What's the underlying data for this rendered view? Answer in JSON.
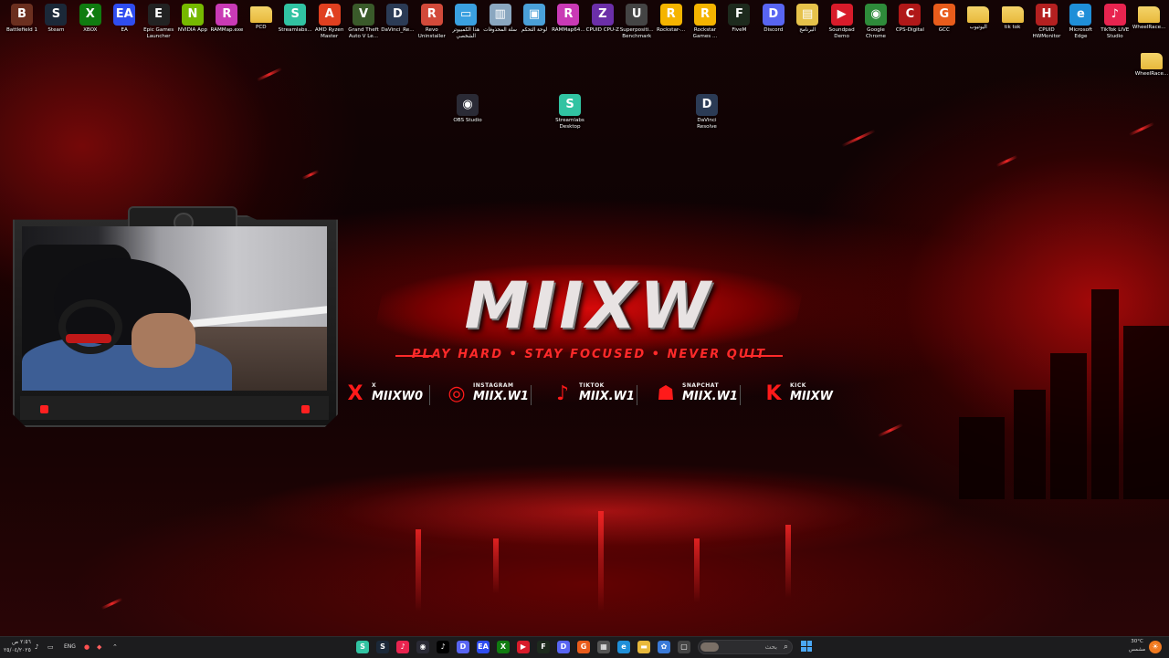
{
  "wallpaper": {
    "brand_title": "MIIXW",
    "tagline": "PLAY HARD • STAY FOCUSED • NEVER QUIT",
    "socials": [
      {
        "network": "X",
        "handle": "MIIXW0",
        "icon": "x-logo-icon",
        "glyph": "X"
      },
      {
        "network": "INSTAGRAM",
        "handle": "MIIX.W1",
        "icon": "instagram-icon",
        "glyph": "◎"
      },
      {
        "network": "TIKTOK",
        "handle": "MIIX.W1",
        "icon": "tiktok-icon",
        "glyph": "♪"
      },
      {
        "network": "SNAPCHAT",
        "handle": "MIIX.W1",
        "icon": "snapchat-icon",
        "glyph": "☗"
      },
      {
        "network": "KICK",
        "handle": "MIIXW",
        "icon": "kick-icon",
        "glyph": "K"
      }
    ],
    "accent_color": "#ff1a1a"
  },
  "desktop_icons_top": [
    {
      "label": "Battlefield 1",
      "icon": "battlefield-icon",
      "color": "#6b2f1f",
      "glyph": "B"
    },
    {
      "label": "Steam",
      "icon": "steam-icon",
      "color": "#1b2838",
      "glyph": "S"
    },
    {
      "label": "XBOX",
      "icon": "xbox-icon",
      "color": "#107c10",
      "glyph": "X"
    },
    {
      "label": "EA",
      "icon": "ea-icon",
      "color": "#2f4df0",
      "glyph": "EA"
    },
    {
      "label": "Epic Games Launcher",
      "icon": "epic-games-icon",
      "color": "#222",
      "glyph": "E"
    },
    {
      "label": "NVIDIA App",
      "icon": "nvidia-icon",
      "color": "#76b900",
      "glyph": "N"
    },
    {
      "label": "RAMMap.exe",
      "icon": "rammap-icon",
      "color": "#c93ab5",
      "glyph": "R"
    },
    {
      "label": "PCD",
      "icon": "folder-icon",
      "color": "#e8b93c",
      "glyph": ""
    },
    {
      "label": "Streamlabs...",
      "icon": "streamlabs-icon",
      "color": "#31c3a2",
      "glyph": "S"
    },
    {
      "label": "AMD Ryzen Master",
      "icon": "amd-ryzen-icon",
      "color": "#e04020",
      "glyph": "A"
    },
    {
      "label": "Grand Theft Auto V Le...",
      "icon": "gta-v-icon",
      "color": "#3a5a2a",
      "glyph": "V"
    },
    {
      "label": "DaVinci_Re...",
      "icon": "davinci-icon",
      "color": "#2b3b55",
      "glyph": "D"
    },
    {
      "label": "Revo Uninstaller",
      "icon": "revo-uninstaller-icon",
      "color": "#d24a3a",
      "glyph": "R"
    },
    {
      "label": "هذا الكمبيوتر الشخصي",
      "icon": "this-pc-icon",
      "color": "#3aa0e0",
      "glyph": "▭"
    },
    {
      "label": "سلة المحذوفات",
      "icon": "recycle-bin-icon",
      "color": "#8aa7c0",
      "glyph": "▥"
    },
    {
      "label": "لوحة التحكم",
      "icon": "control-panel-icon",
      "color": "#4aa0d8",
      "glyph": "▣"
    },
    {
      "label": "RAMMap64...",
      "icon": "rammap64-icon",
      "color": "#c93ab5",
      "glyph": "R"
    },
    {
      "label": "CPUID CPU-Z",
      "icon": "cpu-z-icon",
      "color": "#6b2fa8",
      "glyph": "Z"
    },
    {
      "label": "Superpositi... Benchmark",
      "icon": "superposition-icon",
      "color": "#444",
      "glyph": "U"
    },
    {
      "label": "Rockstar-...",
      "icon": "rockstar-icon",
      "color": "#f5b400",
      "glyph": "R"
    },
    {
      "label": "Rockstar Games ...",
      "icon": "rockstar-games-icon",
      "color": "#f5b400",
      "glyph": "R"
    },
    {
      "label": "FiveM",
      "icon": "fivem-icon",
      "color": "#1d2a1d",
      "glyph": "F"
    },
    {
      "label": "Discord",
      "icon": "discord-icon",
      "color": "#5865f2",
      "glyph": "D"
    },
    {
      "label": "البرنامج",
      "icon": "program-icon",
      "color": "#e6c24a",
      "glyph": "▤"
    },
    {
      "label": "Soundpad Demo",
      "icon": "soundpad-icon",
      "color": "#d81b2a",
      "glyph": "▶"
    },
    {
      "label": "Google Chrome",
      "icon": "chrome-icon",
      "color": "#2e8b3a",
      "glyph": "◉"
    },
    {
      "label": "CPS-Digital",
      "icon": "cps-digital-icon",
      "color": "#b01818",
      "glyph": "C"
    },
    {
      "label": "GCC",
      "icon": "gcc-icon",
      "color": "#e95c1b",
      "glyph": "G"
    },
    {
      "label": "اليوتيوب",
      "icon": "folder-icon",
      "color": "#e8b93c",
      "glyph": ""
    },
    {
      "label": "tik tok",
      "icon": "folder-icon",
      "color": "#e8b93c",
      "glyph": ""
    },
    {
      "label": "CPUID HWMonitor",
      "icon": "hwmonitor-icon",
      "color": "#b42020",
      "glyph": "H"
    },
    {
      "label": "Microsoft Edge",
      "icon": "edge-icon",
      "color": "#1f8fd8",
      "glyph": "e"
    },
    {
      "label": "TikTok LIVE Studio",
      "icon": "tiktok-live-icon",
      "color": "#e8244f",
      "glyph": "♪"
    },
    {
      "label": "WheelRace...",
      "icon": "folder-icon",
      "color": "#e8b93c",
      "glyph": ""
    }
  ],
  "desktop_icons_other": [
    {
      "label": "WheelRace...",
      "icon": "folder-icon",
      "color": "#e8b93c",
      "glyph": ""
    },
    {
      "label": "OBS Studio",
      "icon": "obs-icon",
      "color": "#2a2a35",
      "glyph": "◉"
    },
    {
      "label": "Streamlabs Desktop",
      "icon": "streamlabs-icon",
      "color": "#31c3a2",
      "glyph": "S"
    },
    {
      "label": "DaVinci Resolve",
      "icon": "davinci-icon",
      "color": "#2b3b55",
      "glyph": "D"
    }
  ],
  "taskbar": {
    "clock_time": "٢:٥٦ ص",
    "clock_date": "٢٥/٠٤/٢٠٢٥",
    "language": "ENG",
    "search_placeholder": "بحث",
    "weather_temp": "30°C",
    "weather_desc": "مشمس",
    "apps": [
      {
        "icon": "streamlabs-icon",
        "color": "#31c3a2",
        "glyph": "S"
      },
      {
        "icon": "steam-icon",
        "color": "#1b2838",
        "glyph": "S"
      },
      {
        "icon": "tiktok-live-icon",
        "color": "#e8244f",
        "glyph": "♪"
      },
      {
        "icon": "obs-icon",
        "color": "#2a2a35",
        "glyph": "◉"
      },
      {
        "icon": "tiktok-icon",
        "color": "#000",
        "glyph": "♪"
      },
      {
        "icon": "discord-icon",
        "color": "#5865f2",
        "glyph": "D"
      },
      {
        "icon": "ea-icon",
        "color": "#2f4df0",
        "glyph": "EA"
      },
      {
        "icon": "xbox-icon",
        "color": "#107c10",
        "glyph": "X"
      },
      {
        "icon": "soundpad-icon",
        "color": "#d81b2a",
        "glyph": "▶"
      },
      {
        "icon": "fivem-icon",
        "color": "#1d2a1d",
        "glyph": "F"
      },
      {
        "icon": "discord-icon",
        "color": "#5865f2",
        "glyph": "D"
      },
      {
        "icon": "gcc-icon",
        "color": "#e95c1b",
        "glyph": "G"
      },
      {
        "icon": "calculator-icon",
        "color": "#555",
        "glyph": "▦"
      },
      {
        "icon": "edge-icon",
        "color": "#1f8fd8",
        "glyph": "e"
      },
      {
        "icon": "file-explorer-icon",
        "color": "#e8b93c",
        "glyph": "▬"
      },
      {
        "icon": "photos-icon",
        "color": "#3a7ad8",
        "glyph": "✿"
      },
      {
        "icon": "task-view-icon",
        "color": "#444",
        "glyph": "▢"
      }
    ]
  }
}
